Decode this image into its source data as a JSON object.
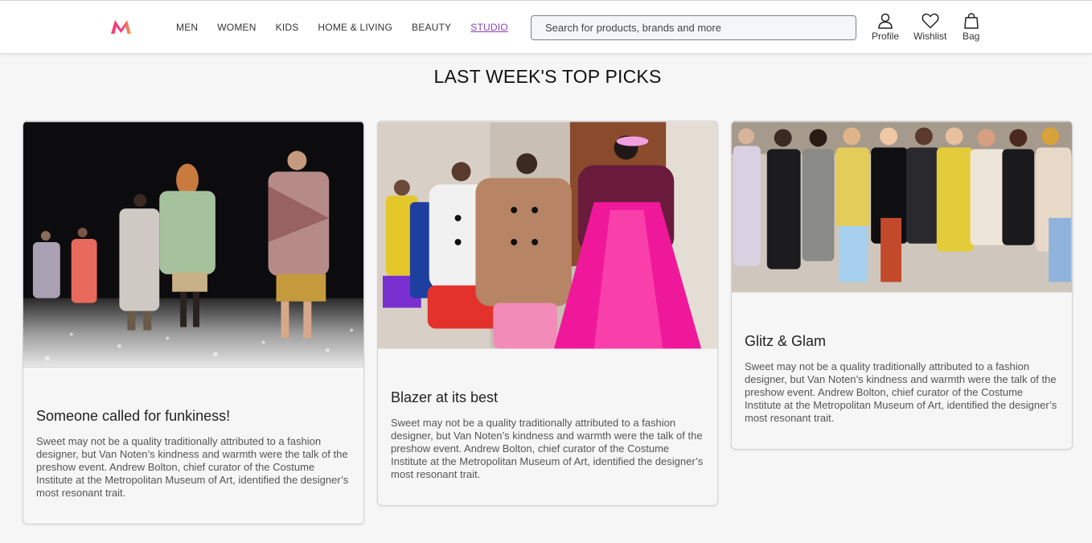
{
  "header": {
    "logo": "myntra-logo",
    "nav": [
      {
        "label": "MEN"
      },
      {
        "label": "WOMEN"
      },
      {
        "label": "KIDS"
      },
      {
        "label": "HOME & LIVING"
      },
      {
        "label": "BEAUTY"
      },
      {
        "label": "STUDIO",
        "active": true
      }
    ],
    "search_placeholder": "Search for products, brands and more",
    "actions": [
      {
        "label": "Profile",
        "icon": "person-icon"
      },
      {
        "label": "Wishlist",
        "icon": "heart-icon"
      },
      {
        "label": "Bag",
        "icon": "bag-icon"
      }
    ]
  },
  "page_title": "LAST WEEK'S TOP PICKS",
  "cards": [
    {
      "title": "Someone called for funkiness!",
      "body": "Sweet may not be a quality traditionally attributed to a fashion designer, but Van Noten’s kindness and warmth were the talk of the preshow event. Andrew Bolton, chief curator of the Costume Institute at the Metropolitan Museum of Art, identified the designer’s most resonant trait.",
      "image": "runway-models-walking-photo"
    },
    {
      "title": "Blazer at its best",
      "body": "Sweet may not be a quality traditionally attributed to a fashion designer, but Van Noten’s kindness and warmth were the talk of the preshow event. Andrew Bolton, chief curator of the Costume Institute at the Metropolitan Museum of Art, identified the designer’s most resonant trait.",
      "image": "backstage-models-coats-photo"
    },
    {
      "title": "Glitz & Glam",
      "body": "Sweet may not be a quality traditionally attributed to a fashion designer, but Van Noten’s kindness and warmth were the talk of the preshow event. Andrew Bolton, chief curator of the Costume Institute at the Metropolitan Museum of Art, identified the designer’s most resonant trait.",
      "image": "models-lineup-photo"
    }
  ],
  "colors": {
    "accent": "#8b3fb8",
    "logo_pink": "#ff3f6c",
    "logo_orange": "#f6a03c"
  }
}
